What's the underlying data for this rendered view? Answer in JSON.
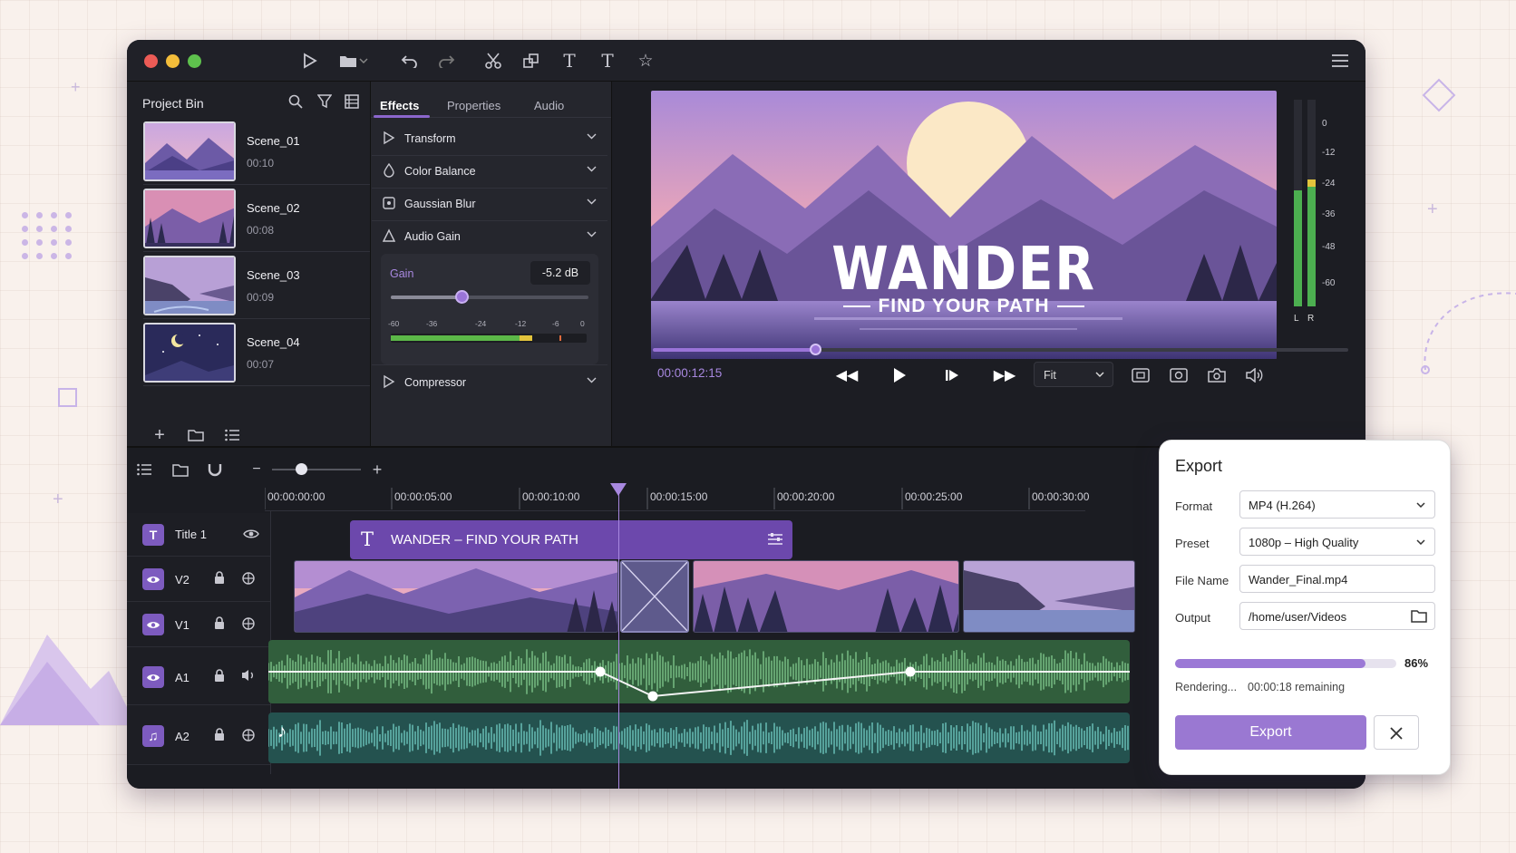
{
  "toolbar": {
    "icons": [
      "play-icon",
      "folder-icon",
      "chevron-down-icon",
      "undo-icon",
      "redo-icon",
      "scissors-icon",
      "duplicate-icon",
      "text-icon",
      "text-alt-icon",
      "star-icon",
      "menu-icon"
    ]
  },
  "project_bin": {
    "title": "Project Bin",
    "items": [
      {
        "name": "Scene_01",
        "duration": "00:10"
      },
      {
        "name": "Scene_02",
        "duration": "00:08"
      },
      {
        "name": "Scene_03",
        "duration": "00:09"
      },
      {
        "name": "Scene_04",
        "duration": "00:07"
      }
    ]
  },
  "inspector": {
    "tabs": [
      "Effects",
      "Properties",
      "Audio"
    ],
    "active_tab": "Effects",
    "effects": [
      {
        "label": "Transform"
      },
      {
        "label": "Color Balance"
      },
      {
        "label": "Gaussian Blur"
      },
      {
        "label": "Audio Gain"
      }
    ],
    "gain": {
      "label": "Gain",
      "value": "-5.2 dB",
      "slider_fraction": 0.36,
      "meter_ticks": [
        "-60",
        "-36",
        "-24",
        "-12",
        "-6",
        "0"
      ]
    },
    "compressor": {
      "label": "Compressor"
    }
  },
  "preview": {
    "title": "WANDER",
    "subtitle": "FIND YOUR PATH",
    "meter_scale": [
      "0",
      "-12",
      "-24",
      "-36",
      "-48",
      "-60"
    ],
    "meter_channels": [
      "L",
      "R"
    ],
    "timecode": "00:00:12:15",
    "scrub_fraction": 0.233,
    "fit_label": "Fit"
  },
  "timeline": {
    "ruler": [
      "00:00:00:00",
      "00:00:05:00",
      "00:00:10:00",
      "00:00:15:00",
      "00:00:20:00",
      "00:00:25:00",
      "00:00:30:00"
    ],
    "tracks": [
      {
        "name": "Title 1",
        "badge": "T"
      },
      {
        "name": "V2",
        "badge": "eye"
      },
      {
        "name": "V1",
        "badge": "eye"
      },
      {
        "name": "A1",
        "badge": "eye"
      },
      {
        "name": "A2",
        "badge": "music"
      }
    ],
    "title_clip": "WANDER – FIND YOUR PATH"
  },
  "export": {
    "title": "Export",
    "format_label": "Format",
    "format_value": "MP4 (H.264)",
    "preset_label": "Preset",
    "preset_value": "1080p – High Quality",
    "filename_label": "File Name",
    "filename_value": "Wander_Final.mp4",
    "output_label": "Output",
    "output_value": "/home/user/Videos",
    "progress_percent": 86,
    "progress_label": "86%",
    "status": "Rendering...",
    "remaining": "00:00:18 remaining",
    "export_button": "Export"
  },
  "colors": {
    "accent": "#8b66cc",
    "panel": "#24252c",
    "window": "#1a1b21",
    "audio_green": "#3f7a4c",
    "audio_teal": "#2e6e6a"
  }
}
